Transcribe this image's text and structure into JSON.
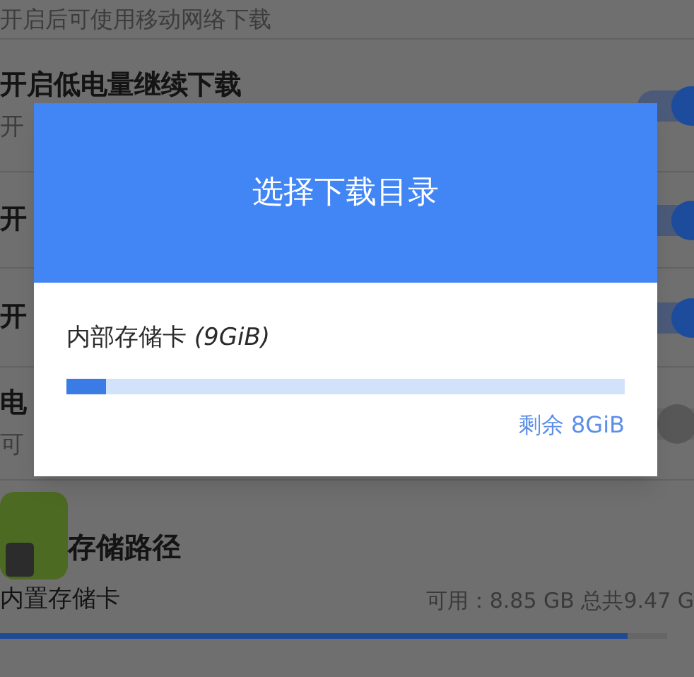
{
  "top_note": "开启后可使用移动网络下载",
  "settings": [
    {
      "title": "开启低电量继续下载",
      "subtitle": "开",
      "on": true
    },
    {
      "title": "开",
      "on": true
    },
    {
      "title": "开",
      "on": true
    },
    {
      "title": "电",
      "subtitle": "可",
      "on": false
    }
  ],
  "storage": {
    "title": "存储路径",
    "location": "内置存储卡",
    "availability": "可用：8.85 GB 总共9.47 G",
    "level": 0.94
  },
  "dialog": {
    "title": "选择下载目录",
    "storage_name": "内部存储卡 *(9GiB)*",
    "level": 0.07,
    "remaining": "剩余 8GiB"
  }
}
